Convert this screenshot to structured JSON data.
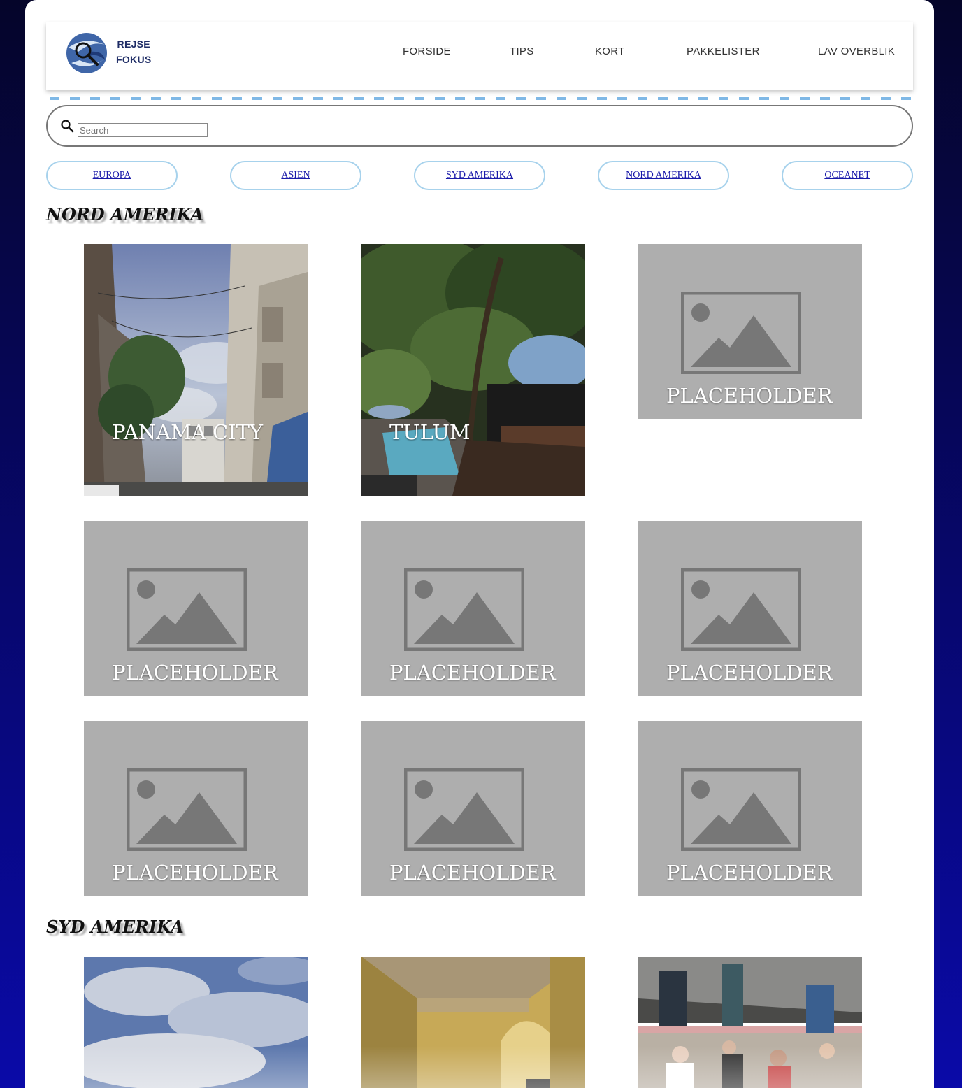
{
  "brand": {
    "line1": "REJSE",
    "line2": "FOKUS"
  },
  "nav": [
    "FORSIDE",
    "TIPS",
    "KORT",
    "PAKKELISTER",
    "LAV OVERBLIK"
  ],
  "search": {
    "placeholder": "Search",
    "value": ""
  },
  "regions": [
    "EUROPA",
    "ASIEN",
    "SYD AMERIKA",
    "NORD AMERIKA",
    "OCEANET"
  ],
  "sections": [
    {
      "title": "NORD AMERIKA",
      "cards": [
        "PANAMA CITY",
        "TULUM",
        "PLACEHOLDER",
        "PLACEHOLDER",
        "PLACEHOLDER",
        "PLACEHOLDER",
        "PLACEHOLDER",
        "PLACEHOLDER",
        "PLACEHOLDER"
      ]
    },
    {
      "title": "SYD AMERIKA",
      "cards": []
    }
  ],
  "colors": {
    "accent": "#a7d2ec",
    "brand": "#1f2d66",
    "placeholder": "#aeaeae"
  }
}
